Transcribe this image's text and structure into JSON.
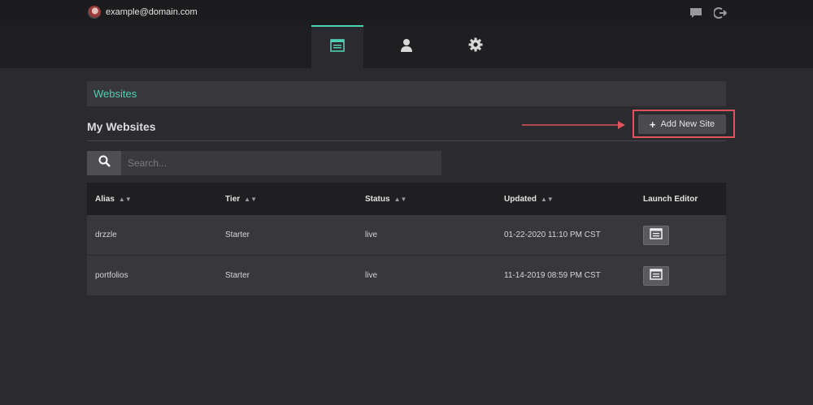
{
  "topbar": {
    "user_email": "example@domain.com",
    "icons": [
      "avatar",
      "chat-icon",
      "logout-icon"
    ]
  },
  "nav": {
    "tabs": [
      {
        "icon": "websites-icon",
        "active": true
      },
      {
        "icon": "user-icon",
        "active": false
      },
      {
        "icon": "gear-icon",
        "active": false
      }
    ]
  },
  "section": {
    "title": "Websites"
  },
  "page": {
    "title": "My Websites"
  },
  "actions": {
    "add_label": "Add New Site"
  },
  "search": {
    "placeholder": "Search..."
  },
  "table": {
    "columns": [
      "Alias",
      "Tier",
      "Status",
      "Updated",
      "Launch Editor"
    ],
    "rows": [
      {
        "alias": "drzzle",
        "tier": "Starter",
        "status": "live",
        "updated": "01-22-2020 11:10 PM CST"
      },
      {
        "alias": "portfolios",
        "tier": "Starter",
        "status": "live",
        "updated": "11-14-2019 08:59 PM CST"
      }
    ]
  },
  "colors": {
    "accent": "#4fd1b3",
    "highlight": "#e0525c",
    "background": "#2b2b2f"
  }
}
